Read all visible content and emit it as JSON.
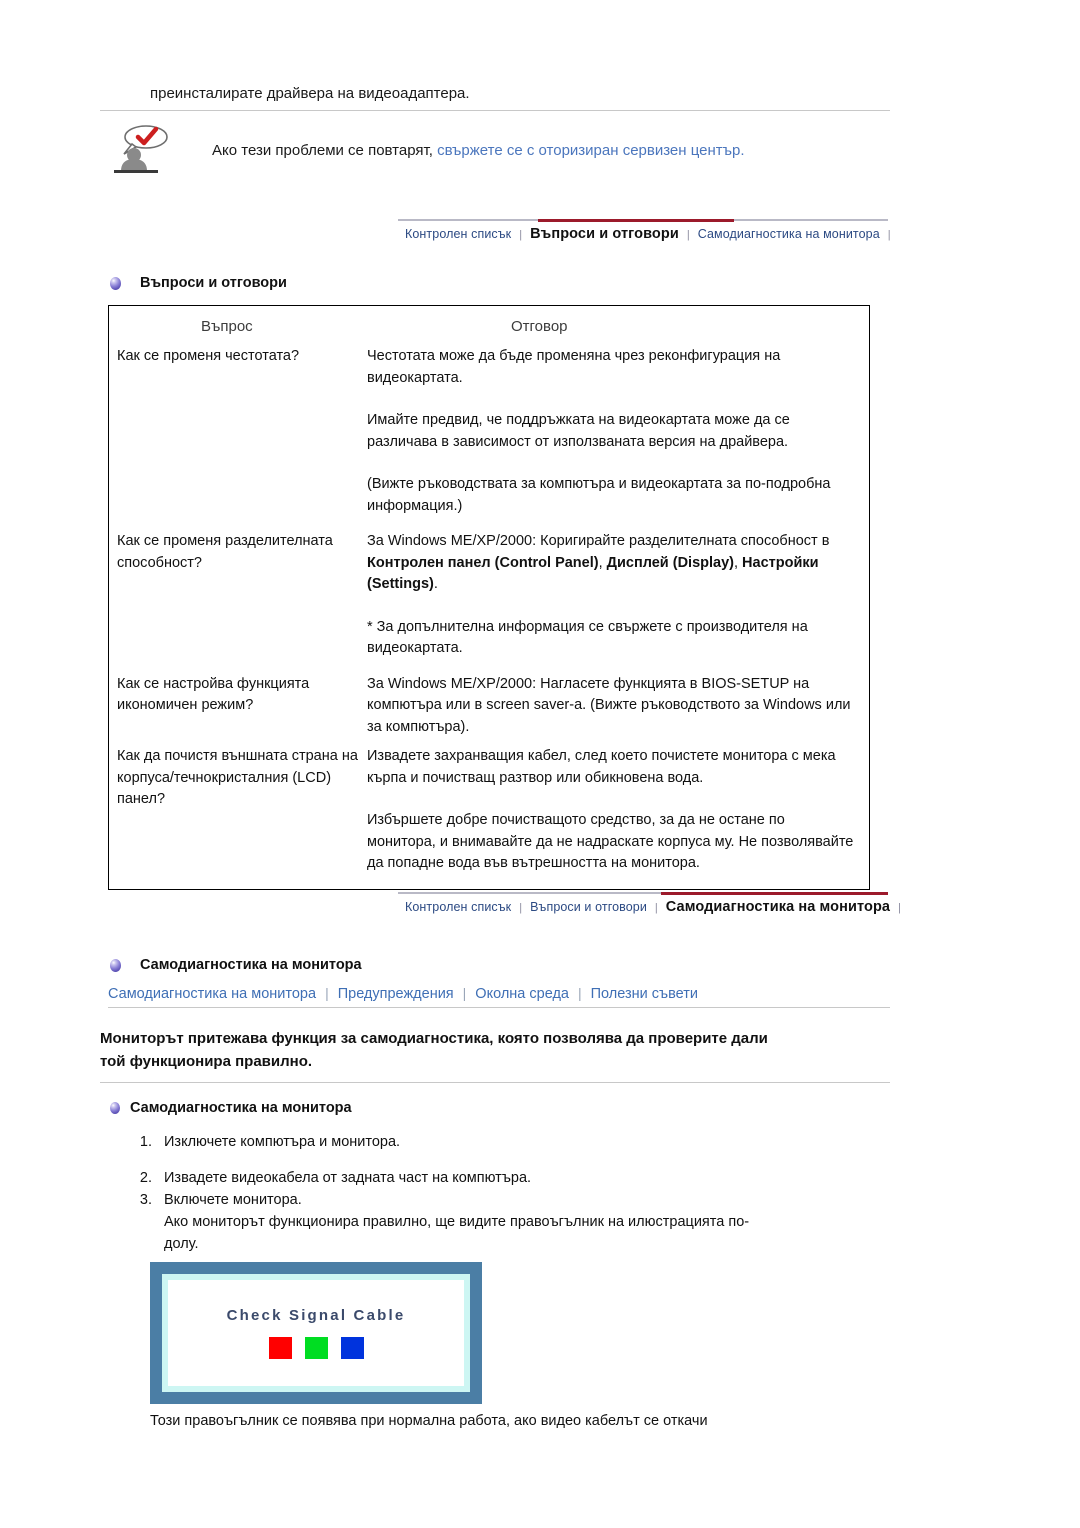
{
  "top": {
    "continuation_text": "преинсталирате драйвера на видеоадаптера."
  },
  "notice": {
    "icon": "person-speech-bubble-check-icon",
    "text_plain": "Ако тези проблеми се повтарят, ",
    "link_text": "свържете се с оторизиран сервизен център.",
    "link_color": "#4b76bd"
  },
  "tabstrip_top": {
    "tabs": [
      {
        "label": "Контролен списък",
        "active": false
      },
      {
        "label": "Въпроси и отговори",
        "active": true
      },
      {
        "label": "Самодиагностика на монитора",
        "active": false
      }
    ],
    "separator": "|",
    "highlight_color": "#9c1a2b",
    "rail_color": "#b9b9c6"
  },
  "faq_section": {
    "heading": "Въпроси и отговори",
    "bullet_icon": "purple-orb-bullet-icon",
    "table": {
      "headers": [
        "Въпрос",
        "Отговор"
      ],
      "rows": [
        {
          "question": "Как се променя честотата?",
          "answer_paragraphs": [
            "Честотата може да бъде променяна чрез реконфигурация на видеокартата.",
            "Имайте предвид, че поддръжката на видеокартата може да се различава в зависимост от използваната версия на драйвера.",
            "(Вижте ръководствата за компютъра и видеокартата за по-подробна информация.)"
          ]
        },
        {
          "question": "Как се променя разделителната способност?",
          "answer_lead_plain": "За Windows ME/XP/2000: Коригирайте разделителната способност в ",
          "answer_bold_1": "Контролен панел (Control Panel)",
          "answer_mid_1": ", ",
          "answer_bold_2": "Дисплей (Display)",
          "answer_mid_2": ", ",
          "answer_bold_3": "Настройки (Settings)",
          "answer_tail": ".",
          "answer_paragraphs": [
            "* За допълнителна информация се свържете с производителя на видеокартата."
          ]
        },
        {
          "question": "Как се настройва функцията икономичен режим?",
          "answer_paragraphs": [
            "За Windows ME/XP/2000: Нагласете функцията в BIOS-SETUP на компютъра или в screen saver-a. (Вижте ръководството за Windows или за компютъра)."
          ]
        },
        {
          "question": "Как да почистя външната страна на корпуса/течнокристалния (LCD) панел?",
          "answer_paragraphs": [
            "Извадете захранващия кабел, след което почистете монитора с мека кърпа и почистващ разтвор или обикновена вода.",
            "Избършете добре почистващото средство, за да не остане по монитора, и внимавайте да не надраскате корпуса му. Не позволявайте да попадне вода във вътрешността на монитора."
          ]
        }
      ]
    }
  },
  "tabstrip_bottom": {
    "tabs": [
      {
        "label": "Контролен списък",
        "active": false
      },
      {
        "label": "Въпроси и отговори",
        "active": false
      },
      {
        "label": "Самодиагностика на монитора",
        "active": true
      }
    ],
    "separator": "|",
    "highlight_color": "#9c1a2b",
    "rail_color": "#b9b9c6"
  },
  "selfdiag_section": {
    "heading": "Самодиагностика на монитора",
    "bullet_icon": "purple-orb-bullet-icon",
    "sublinks": [
      "Самодиагностика на монитора",
      "Предупреждения",
      "Околна среда",
      "Полезни съвети"
    ],
    "sublink_separator": "|",
    "sublink_color": "#3f6fb5",
    "lead_line_1": "Мониторът притежава функция за самодиагностика, която позволява да проверите дали",
    "lead_line_2": "той функционира правилно.",
    "subheading": "Самодиагностика на монитора",
    "steps": [
      {
        "num": "1.",
        "text": "Изключете компютъра и монитора."
      },
      {
        "num": "2.",
        "text": "Извадете видеокабела от задната част на компютъра."
      },
      {
        "num": "3.",
        "text": "Включете монитора."
      }
    ],
    "step3_extra_line_1": "Ако мониторът функционира правилно, ще видите правоъгълник на илюстрацията по-",
    "step3_extra_line_2": "долу.",
    "monitor_graphic": {
      "message": "Check Signal Cable",
      "swatches": [
        "#ff0000",
        "#00dd22",
        "#0033dd"
      ],
      "bezel_color": "#4b7ea5",
      "glow_color": "#cdf6f3",
      "screen_color": "#ffffff",
      "message_color": "#3b4a6b"
    },
    "footnote": "Този правоъгълник се появява при нормална работа, ако видео кабелът се откачи"
  }
}
